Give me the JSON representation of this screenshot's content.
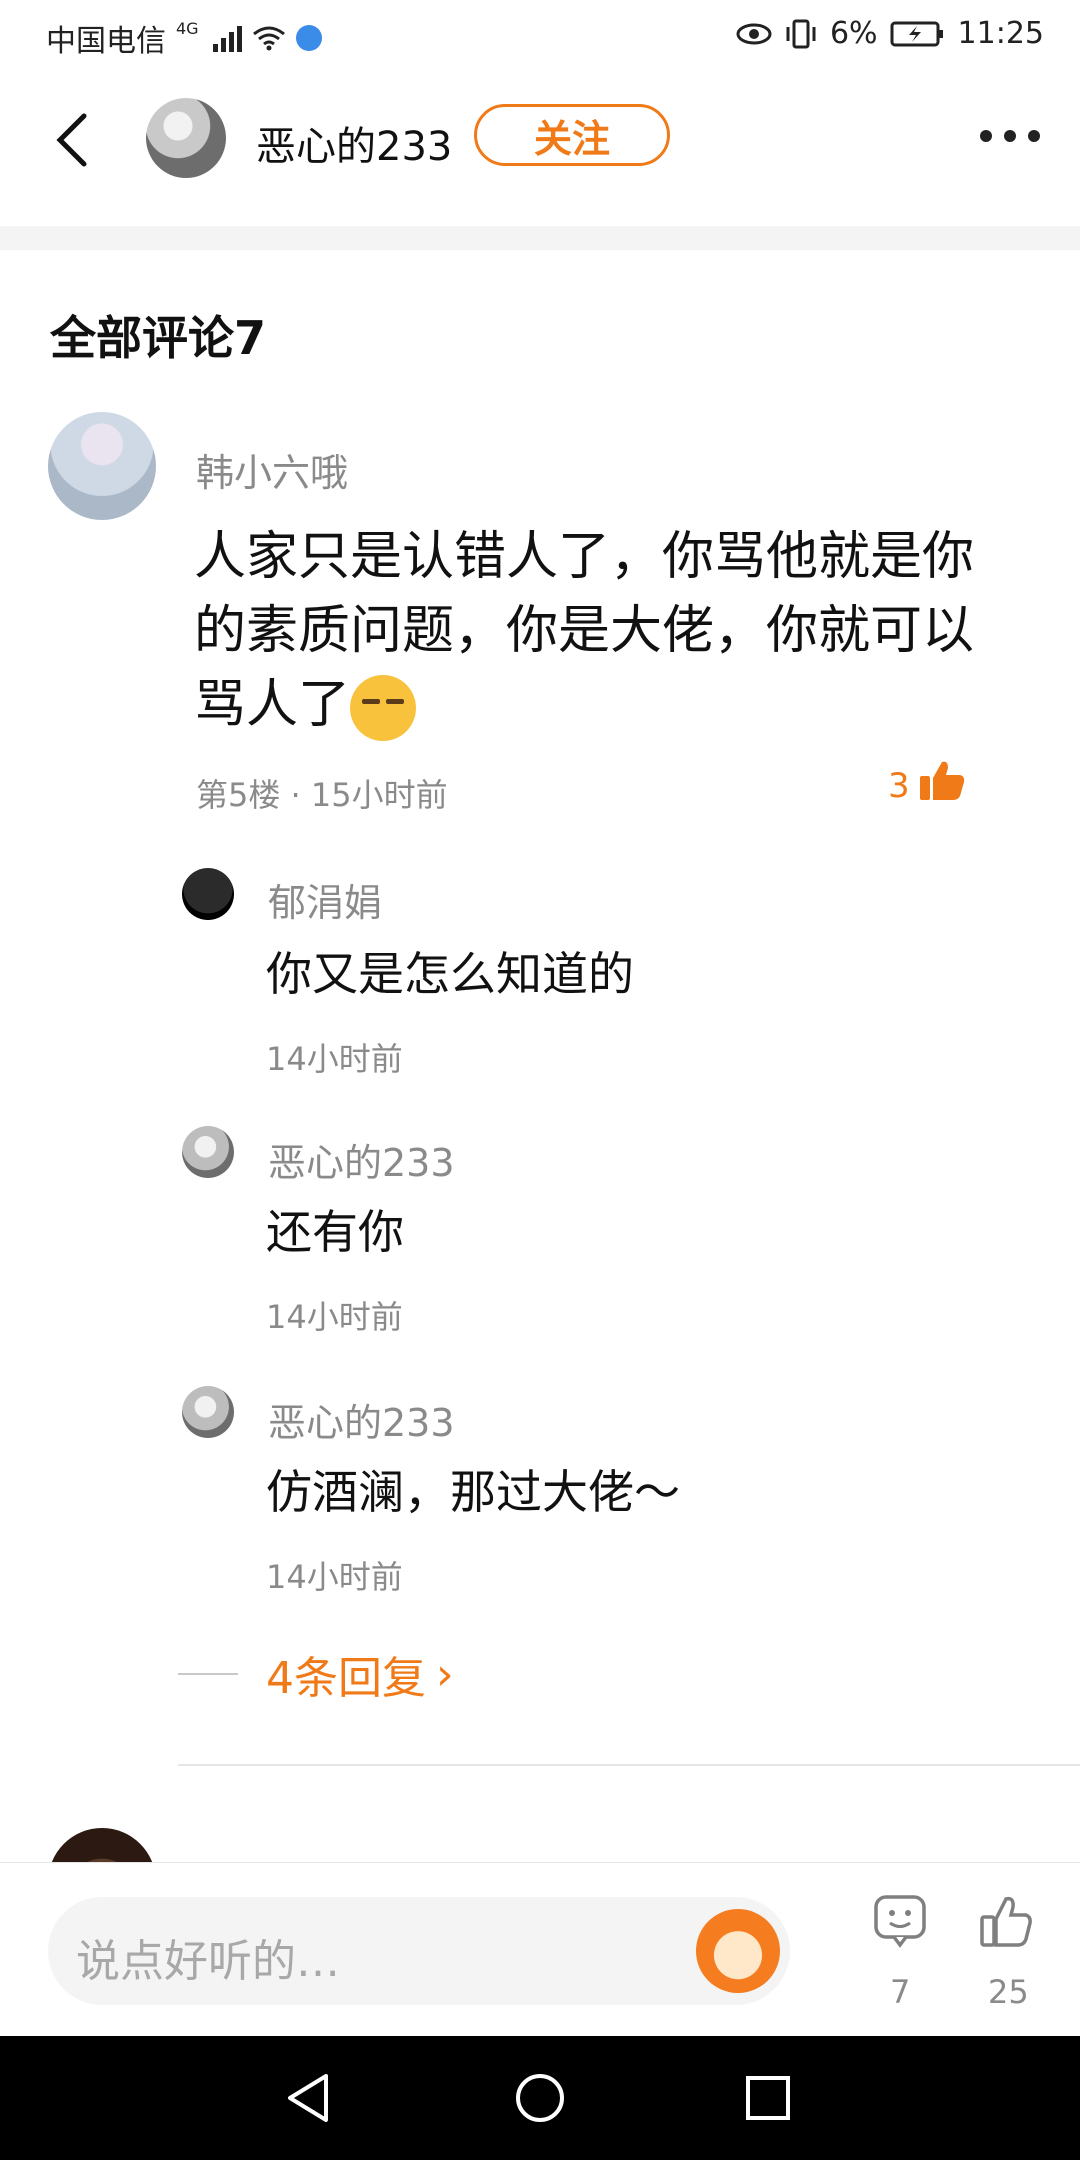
{
  "status_bar": {
    "carrier": "中国电信",
    "network": "4G",
    "battery": "6%",
    "time": "11:25"
  },
  "header": {
    "back_icon": "chevron-left-icon",
    "username": "恶心的233",
    "follow_label": "关注",
    "more_icon": "more-horizontal-icon"
  },
  "comments_section": {
    "title": "全部评论7"
  },
  "comment": {
    "author": "韩小六哦",
    "text": "人家只是认错人了，你骂他就是你的素质问题，你是大佬，你就可以骂人了",
    "meta": "第5楼 · 15小时前",
    "likes": "3",
    "replies": [
      {
        "author": "郁涓娟",
        "text": "你又是怎么知道的",
        "time": "14小时前"
      },
      {
        "author": "恶心的233",
        "text": "还有你",
        "time": "14小时前"
      },
      {
        "author": "恶心的233",
        "text": "仿酒澜，那过大佬～",
        "time": "14小时前"
      }
    ],
    "more_replies_label": "4条回复"
  },
  "bottom_bar": {
    "input_placeholder": "说点好听的…",
    "comment_count": "7",
    "like_count": "25"
  },
  "colors": {
    "accent": "#f07a17",
    "muted_text": "#8a8a8a",
    "divider": "#f4f4f4"
  }
}
